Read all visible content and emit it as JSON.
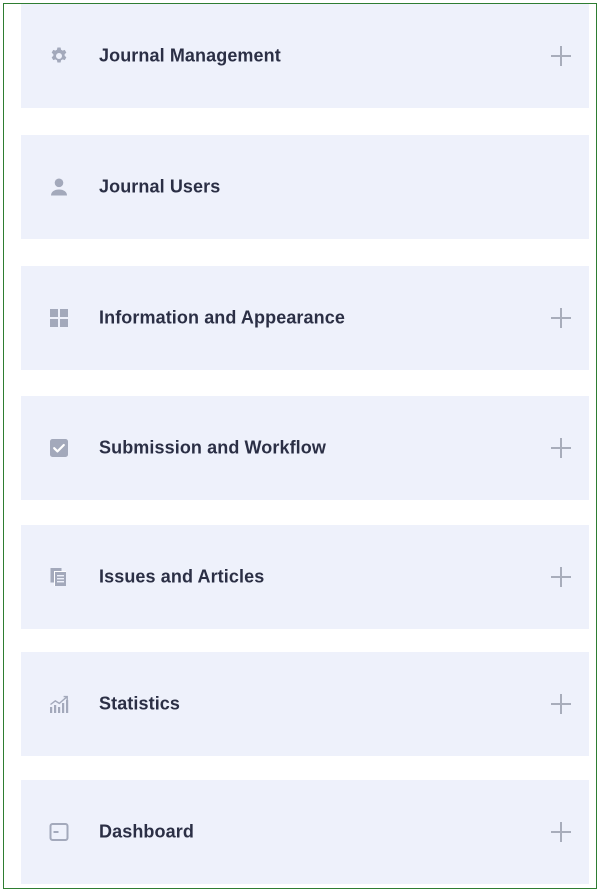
{
  "menu": {
    "items": [
      {
        "label": "Journal Management",
        "icon": "gear-icon",
        "expandable": true
      },
      {
        "label": "Journal Users",
        "icon": "user-icon",
        "expandable": false
      },
      {
        "label": "Information and Appearance",
        "icon": "grid-icon",
        "expandable": true
      },
      {
        "label": "Submission and Workflow",
        "icon": "checkbox-icon",
        "expandable": true
      },
      {
        "label": "Issues and Articles",
        "icon": "documents-icon",
        "expandable": true
      },
      {
        "label": "Statistics",
        "icon": "chart-icon",
        "expandable": true
      },
      {
        "label": "Dashboard",
        "icon": "dashboard-icon",
        "expandable": true
      }
    ]
  },
  "colors": {
    "item_background": "#eef1fb",
    "label_text": "#2b2f45",
    "icon": "#a3a9bb",
    "expand_icon": "#a8adbb",
    "frame_border": "#2e7d32"
  }
}
